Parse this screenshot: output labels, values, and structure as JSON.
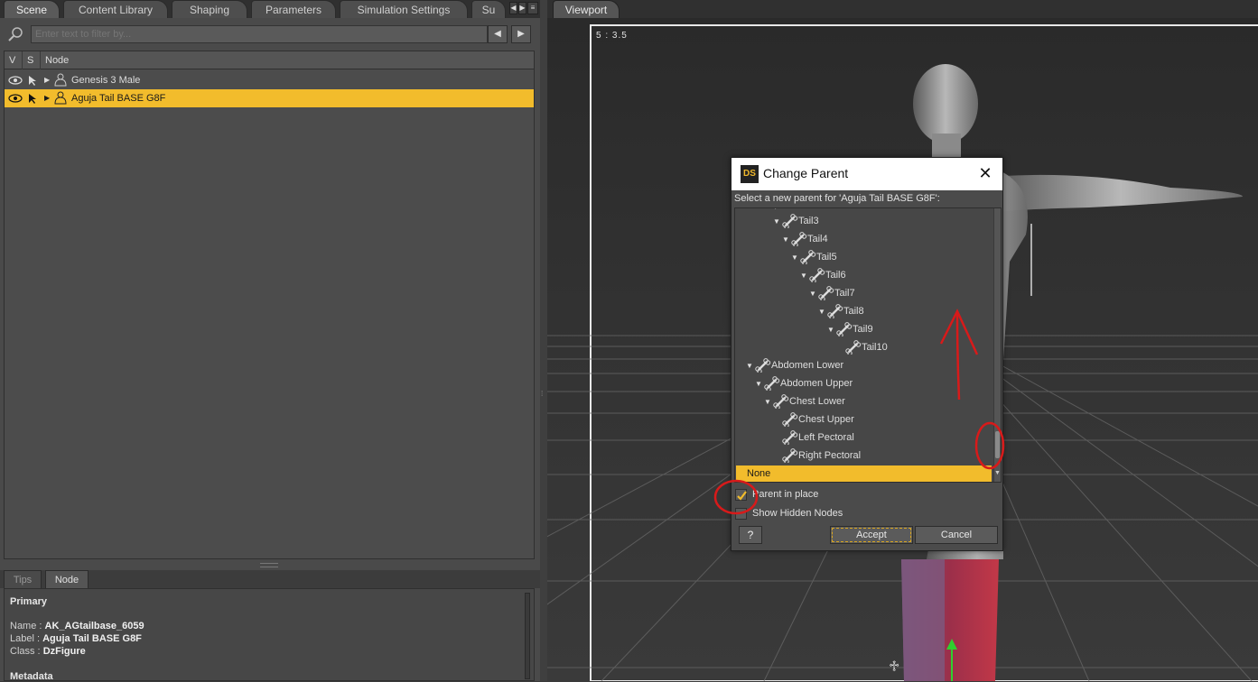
{
  "left_tabs": [
    "Scene",
    "Content Library",
    "Shaping",
    "Parameters",
    "Simulation Settings",
    "Su"
  ],
  "filter": {
    "placeholder": "Enter text to filter by..."
  },
  "tree": {
    "headers": [
      "V",
      "S",
      "Node"
    ],
    "rows": [
      {
        "label": "Genesis 3 Male",
        "selected": false
      },
      {
        "label": "Aguja Tail BASE G8F",
        "selected": true
      }
    ]
  },
  "bottom_tabs": [
    "Tips",
    "Node"
  ],
  "info": {
    "section": "Primary",
    "name_key": "Name :",
    "name_val": "AK_AGtailbase_6059",
    "label_key": "Label :",
    "label_val": "Aguja Tail BASE G8F",
    "class_key": "Class :",
    "class_val": "DzFigure",
    "metadata": "Metadata"
  },
  "viewport": {
    "tab": "Viewport",
    "aspect_label": "5 : 3.5"
  },
  "dialog": {
    "logo": "DS",
    "title": "Change Parent",
    "close": "✕",
    "prompt": "Select a new parent for 'Aguja Tail BASE G8F':",
    "items": [
      {
        "label": "Tail3",
        "depth": 0,
        "expanded": true
      },
      {
        "label": "Tail4",
        "depth": 1,
        "expanded": true
      },
      {
        "label": "Tail5",
        "depth": 2,
        "expanded": true
      },
      {
        "label": "Tail6",
        "depth": 3,
        "expanded": true
      },
      {
        "label": "Tail7",
        "depth": 4,
        "expanded": true
      },
      {
        "label": "Tail8",
        "depth": 5,
        "expanded": true
      },
      {
        "label": "Tail9",
        "depth": 6,
        "expanded": true
      },
      {
        "label": "Tail10",
        "depth": 7,
        "expanded": false
      },
      {
        "label": "Abdomen Lower",
        "depth": -3,
        "expanded": true
      },
      {
        "label": "Abdomen Upper",
        "depth": -2,
        "expanded": true
      },
      {
        "label": "Chest Lower",
        "depth": -1,
        "expanded": true
      },
      {
        "label": "Chest Upper",
        "depth": 0,
        "expanded": false
      },
      {
        "label": "Left Pectoral",
        "depth": 0,
        "expanded": false
      },
      {
        "label": "Right Pectoral",
        "depth": 0,
        "expanded": false
      }
    ],
    "selected_item": "None",
    "parent_in_place": {
      "label": "Parent in place",
      "checked": true
    },
    "show_hidden": {
      "label": "Show Hidden Nodes",
      "checked": false
    },
    "help": "?",
    "accept": "Accept",
    "cancel": "Cancel"
  },
  "colors": {
    "selection": "#f2bc2c",
    "annotation": "#d81a1a"
  }
}
